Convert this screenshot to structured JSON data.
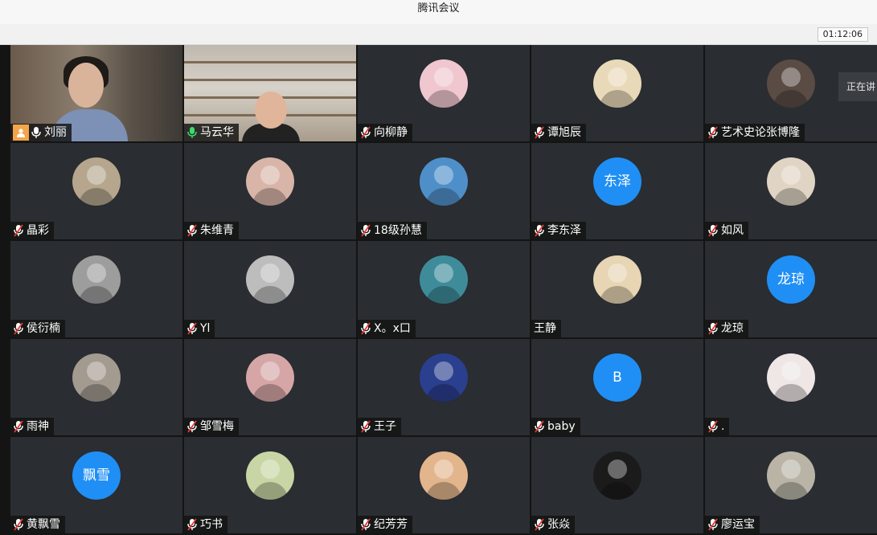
{
  "window": {
    "title": "腾讯会议",
    "timer": "01:12:06"
  },
  "speaking_label": "正在讲",
  "colors": {
    "stage_bg": "#141414",
    "tile_bg": "#2a2d31",
    "accent": "#1f8ff5",
    "active_border": "#3cb96a"
  },
  "participants": [
    {
      "name": "刘丽",
      "avatar_type": "video",
      "mic": "on-icon",
      "host": true
    },
    {
      "name": "马云华",
      "avatar_type": "video",
      "mic": "active-icon",
      "active": true
    },
    {
      "name": "向柳静",
      "avatar_type": "photo",
      "photo_color": "#f0c7cf",
      "mic": "muted-icon"
    },
    {
      "name": "谭旭辰",
      "avatar_type": "photo",
      "photo_color": "#e8d9b8",
      "mic": "muted-icon"
    },
    {
      "name": "艺术史论张博隆",
      "avatar_type": "photo",
      "photo_color": "#5a4b44",
      "mic": "muted-icon"
    },
    {
      "name": "晶彩",
      "avatar_type": "photo",
      "photo_color": "#b5a68d",
      "mic": "muted-icon"
    },
    {
      "name": "朱维青",
      "avatar_type": "photo",
      "photo_color": "#d8b5a8",
      "mic": "muted-icon"
    },
    {
      "name": "18级孙慧",
      "avatar_type": "photo",
      "photo_color": "#4f8fc9",
      "mic": "muted-icon"
    },
    {
      "name": "李东泽",
      "avatar_type": "text",
      "avatar_text": "东泽",
      "mic": "muted-icon"
    },
    {
      "name": "如风",
      "avatar_type": "photo",
      "photo_color": "#e0d4c4",
      "mic": "muted-icon"
    },
    {
      "name": "侯衍楠",
      "avatar_type": "photo",
      "photo_color": "#9d9d9d",
      "mic": "muted-icon"
    },
    {
      "name": "Yl",
      "avatar_type": "photo",
      "photo_color": "#bdbdbd",
      "mic": "muted-icon"
    },
    {
      "name": "X。x口",
      "avatar_type": "photo",
      "photo_color": "#3e8c9a",
      "mic": "muted-icon"
    },
    {
      "name": "王静",
      "avatar_type": "photo",
      "photo_color": "#e7d5b3",
      "mic": "none"
    },
    {
      "name": "龙琼",
      "avatar_type": "text",
      "avatar_text": "龙琼",
      "mic": "muted-icon"
    },
    {
      "name": "雨神",
      "avatar_type": "photo",
      "photo_color": "#a39a90",
      "mic": "muted-icon"
    },
    {
      "name": "邹雪梅",
      "avatar_type": "photo",
      "photo_color": "#d6a6a6",
      "mic": "muted-icon"
    },
    {
      "name": "王子",
      "avatar_type": "photo",
      "photo_color": "#2b3f8f",
      "mic": "muted-icon"
    },
    {
      "name": "baby",
      "avatar_type": "text",
      "avatar_text": "B",
      "mic": "muted-icon"
    },
    {
      "name": ".",
      "avatar_type": "photo",
      "photo_color": "#efe6e6",
      "mic": "muted-icon"
    },
    {
      "name": "黄飘雪",
      "avatar_type": "text",
      "avatar_text": "飘雪",
      "mic": "muted-icon"
    },
    {
      "name": "巧书",
      "avatar_type": "photo",
      "photo_color": "#c7d6a4",
      "mic": "muted-icon"
    },
    {
      "name": "纪芳芳",
      "avatar_type": "photo",
      "photo_color": "#e2b58c",
      "mic": "muted-icon"
    },
    {
      "name": "张焱",
      "avatar_type": "photo",
      "photo_color": "#1b1b1b",
      "mic": "muted-icon"
    },
    {
      "name": "廖运宝",
      "avatar_type": "photo",
      "photo_color": "#b9b4a6",
      "mic": "muted-icon"
    }
  ]
}
